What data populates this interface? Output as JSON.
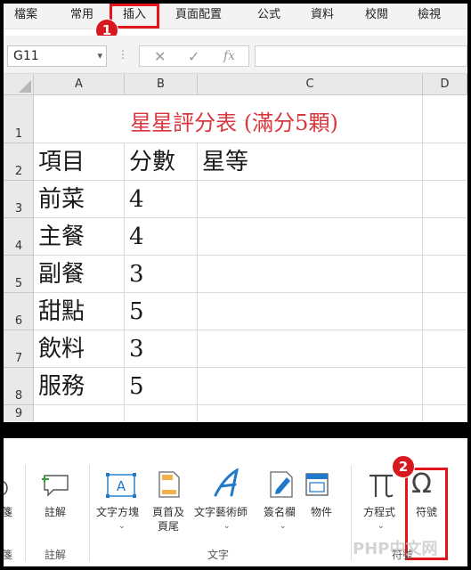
{
  "menu": {
    "tabs": [
      "檔案",
      "常用",
      "插入",
      "頁面配置",
      "公式",
      "資料",
      "校閱",
      "檢視"
    ]
  },
  "badges": {
    "one": "1",
    "two": "2"
  },
  "formula_bar": {
    "name_box": "G11",
    "icons": {
      "cancel": "cancel-x-icon",
      "enter": "check-icon",
      "function": "fx-icon"
    },
    "fx_label": "fx"
  },
  "sheet": {
    "columns": [
      "A",
      "B",
      "C",
      "D"
    ],
    "rows": [
      "1",
      "2",
      "3",
      "4",
      "5",
      "6",
      "7",
      "8",
      "9"
    ],
    "title": "星星評分表 (滿分5顆)",
    "headers": {
      "item": "項目",
      "score": "分數",
      "rating": "星等"
    },
    "data": [
      {
        "item": "前菜",
        "score": "4"
      },
      {
        "item": "主餐",
        "score": "4"
      },
      {
        "item": "副餐",
        "score": "3"
      },
      {
        "item": "甜點",
        "score": "5"
      },
      {
        "item": "飲料",
        "score": "3"
      },
      {
        "item": "服務",
        "score": "5"
      }
    ]
  },
  "ribbon": {
    "partial_left_label": "箋",
    "comment": {
      "label": "註解",
      "group": "註解"
    },
    "textbox": {
      "label": "文字方塊"
    },
    "header_footer": {
      "line1": "頁首及",
      "line2": "頁尾"
    },
    "wordart": {
      "label": "文字藝術師"
    },
    "signature": {
      "label": "簽名欄"
    },
    "object": {
      "label": "物件"
    },
    "text_group": "文字",
    "equation": {
      "label": "方程式"
    },
    "symbol": {
      "label": "符號",
      "glyph": "Ω"
    },
    "symbols_group": "符號",
    "partial_left_group": "箋"
  },
  "watermark": "PHP中文网",
  "colors": {
    "accent_red": "#e4141b",
    "title_red": "#d9363e",
    "icon_blue": "#1f78c8"
  }
}
